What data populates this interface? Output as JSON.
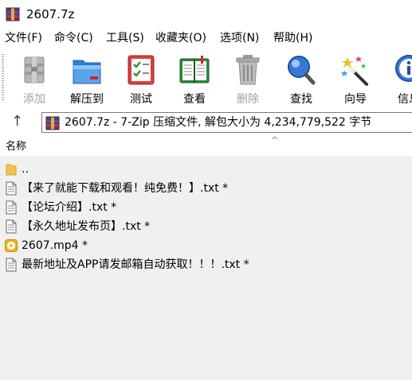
{
  "window": {
    "title": "2607.7z"
  },
  "menu": [
    {
      "label": "文件(F)"
    },
    {
      "label": "命令(C)"
    },
    {
      "label": "工具(S)"
    },
    {
      "label": "收藏夹(O)"
    },
    {
      "label": "选项(N)"
    },
    {
      "label": "帮助(H)"
    }
  ],
  "toolbar": [
    {
      "label": "添加",
      "icon": "add-archive-icon",
      "enabled": false
    },
    {
      "label": "解压到",
      "icon": "extract-folder-icon",
      "enabled": true
    },
    {
      "label": "测试",
      "icon": "test-checklist-icon",
      "enabled": true
    },
    {
      "label": "查看",
      "icon": "view-book-icon",
      "enabled": true
    },
    {
      "label": "删除",
      "icon": "delete-trash-icon",
      "enabled": false
    },
    {
      "label": "查找",
      "icon": "find-magnifier-icon",
      "enabled": true
    },
    {
      "label": "向导",
      "icon": "wizard-wand-icon",
      "enabled": true
    },
    {
      "label": "信息",
      "icon": "info-icon",
      "enabled": true
    }
  ],
  "address": {
    "up_symbol": "↑",
    "text": "2607.7z - 7-Zip 压缩文件, 解包大小为 4,234,779,522 字节"
  },
  "list": {
    "sort_indicator": "^",
    "columns": [
      {
        "label": "名称"
      }
    ],
    "rows": [
      {
        "name": "..",
        "icon": "folder-icon"
      },
      {
        "name": "【来了就能下载和观看！纯免费！】.txt *",
        "icon": "text-file-icon"
      },
      {
        "name": "【论坛介绍】.txt *",
        "icon": "text-file-icon"
      },
      {
        "name": "【永久地址发布页】.txt *",
        "icon": "text-file-icon"
      },
      {
        "name": "2607.mp4 *",
        "icon": "video-file-icon"
      },
      {
        "name": "最新地址及APP请发邮箱自动获取！！！.txt *",
        "icon": "text-file-icon"
      }
    ]
  },
  "colors": {
    "list_background": "#f0f0f0",
    "disabled_text": "#a0a0a0",
    "accent_blue": "#2f7fd8"
  }
}
